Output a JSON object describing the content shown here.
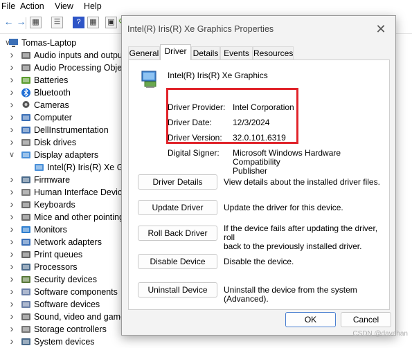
{
  "menubar": {
    "items": [
      "File",
      "Action",
      "View",
      "Help"
    ]
  },
  "tree": {
    "root": "Tomas-Laptop",
    "items": [
      {
        "label": "Audio inputs and outputs",
        "icon": "speaker-icon"
      },
      {
        "label": "Audio Processing Objects",
        "icon": "speaker-icon"
      },
      {
        "label": "Batteries",
        "icon": "battery-icon"
      },
      {
        "label": "Bluetooth",
        "icon": "bluetooth-icon"
      },
      {
        "label": "Cameras",
        "icon": "camera-icon"
      },
      {
        "label": "Computer",
        "icon": "computer-icon"
      },
      {
        "label": "DellInstrumentation",
        "icon": "device-icon"
      },
      {
        "label": "Disk drives",
        "icon": "disk-icon"
      },
      {
        "label": "Display adapters",
        "icon": "display-adapter-icon"
      },
      {
        "label": "Intel(R) Iris(R) Xe Graphics",
        "icon": "display-adapter-icon"
      },
      {
        "label": "Firmware",
        "icon": "chip-icon"
      },
      {
        "label": "Human Interface Devices",
        "icon": "hid-icon"
      },
      {
        "label": "Keyboards",
        "icon": "keyboard-icon"
      },
      {
        "label": "Mice and other pointing devices",
        "icon": "mouse-icon"
      },
      {
        "label": "Monitors",
        "icon": "monitor-icon"
      },
      {
        "label": "Network adapters",
        "icon": "network-icon"
      },
      {
        "label": "Print queues",
        "icon": "printer-icon"
      },
      {
        "label": "Processors",
        "icon": "processor-icon"
      },
      {
        "label": "Security devices",
        "icon": "security-icon"
      },
      {
        "label": "Software components",
        "icon": "software-icon"
      },
      {
        "label": "Software devices",
        "icon": "software-icon"
      },
      {
        "label": "Sound, video and game controllers",
        "icon": "speaker-icon"
      },
      {
        "label": "Storage controllers",
        "icon": "storage-icon"
      },
      {
        "label": "System devices",
        "icon": "system-icon"
      }
    ]
  },
  "dialog": {
    "title": "Intel(R) Iris(R) Xe Graphics Properties",
    "tabs": [
      "General",
      "Driver",
      "Details",
      "Events",
      "Resources"
    ],
    "active_tab": "Driver",
    "device_name": "Intel(R) Iris(R) Xe Graphics",
    "fields": {
      "provider_label": "Driver Provider:",
      "provider_value": "Intel Corporation",
      "date_label": "Driver Date:",
      "date_value": "12/3/2024",
      "version_label": "Driver Version:",
      "version_value": "32.0.101.6319",
      "signer_label": "Digital Signer:",
      "signer_value_line1": "Microsoft Windows Hardware Compatibility",
      "signer_value_line2": "Publisher"
    },
    "actions": {
      "details_label": "Driver Details",
      "details_desc": "View details about the installed driver files.",
      "update_label": "Update Driver",
      "update_desc": "Update the driver for this device.",
      "rollback_label": "Roll Back Driver",
      "rollback_desc_line1": "If the device fails after updating the driver, roll",
      "rollback_desc_line2": "back to the previously installed driver.",
      "disable_label": "Disable Device",
      "disable_desc": "Disable the device.",
      "uninstall_label": "Uninstall Device",
      "uninstall_desc": "Uninstall the device from the system (Advanced)."
    },
    "ok_label": "OK",
    "cancel_label": "Cancel",
    "highlight_color": "#e0232a"
  },
  "watermark": "CSDN @davehan"
}
